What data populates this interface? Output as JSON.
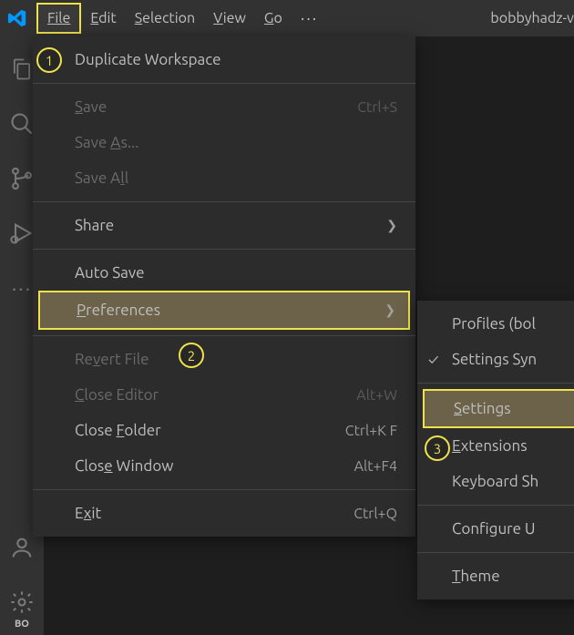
{
  "menubar": {
    "items": [
      {
        "label": "File"
      },
      {
        "label": "Edit"
      },
      {
        "label": "Selection"
      },
      {
        "label": "View"
      },
      {
        "label": "Go"
      }
    ],
    "title": "bobbyhadz-v"
  },
  "fileMenu": {
    "duplicateWorkspace": "Duplicate Workspace",
    "save": "Save",
    "saveShortcut": "Ctrl+S",
    "saveAs": "Save As...",
    "saveAll": "Save All",
    "share": "Share",
    "autoSave": "Auto Save",
    "preferences": "Preferences",
    "revertFile": "Revert File",
    "closeEditor": "Close Editor",
    "closeEditorShortcut": "Alt+W",
    "closeFolder": "Close Folder",
    "closeFolderShortcut": "Ctrl+K F",
    "closeWindow": "Close Window",
    "closeWindowShortcut": "Alt+F4",
    "exit": "Exit",
    "exitShortcut": "Ctrl+Q"
  },
  "submenu": {
    "profiles": "Profiles (bol",
    "settingsSync": "Settings Syn",
    "settings": "Settings",
    "extensions": "Extensions",
    "keyboard": "Keyboard Sh",
    "configure": "Configure U",
    "theme": "Theme"
  },
  "callouts": {
    "c1": "1",
    "c2": "2",
    "c3": "3"
  },
  "badge": "BO"
}
